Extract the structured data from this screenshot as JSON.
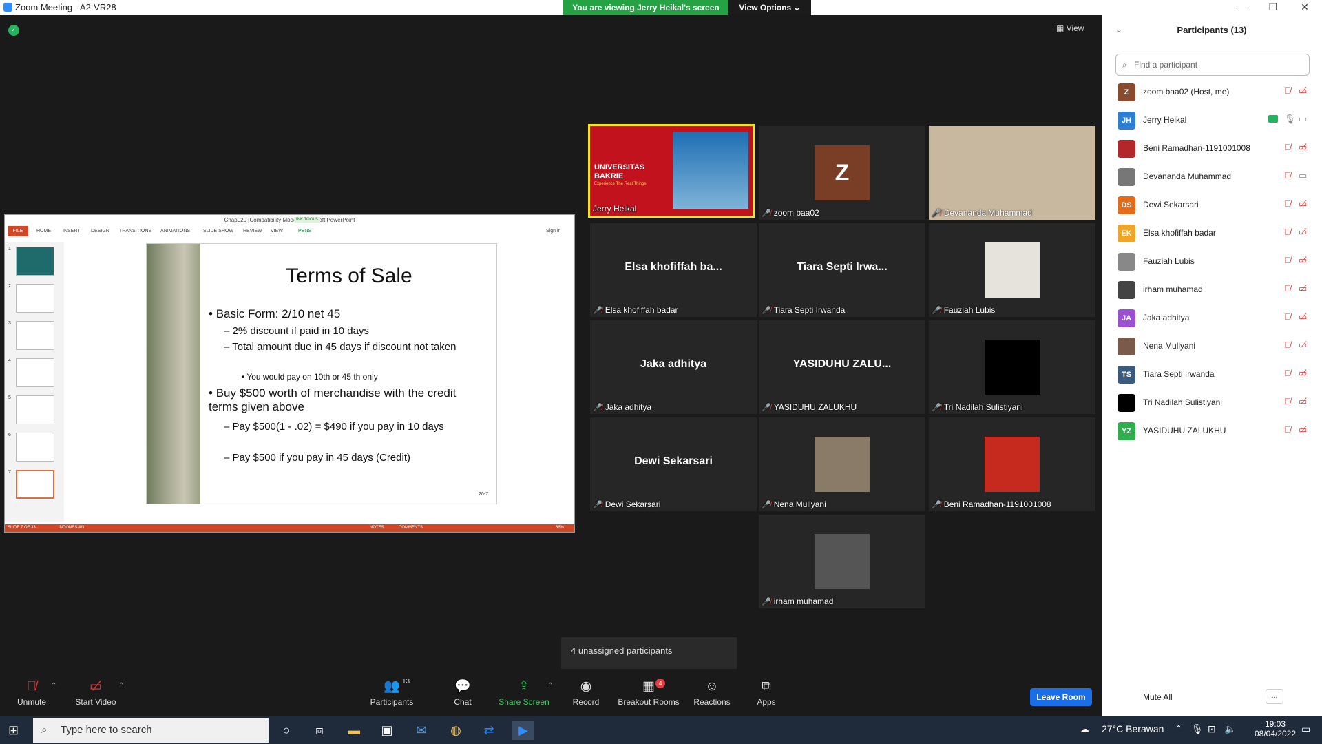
{
  "window": {
    "title": "Zoom Meeting - A2-VR28",
    "minimize": "—",
    "restore": "❐",
    "close": "✕"
  },
  "banner": {
    "viewing": "You are viewing Jerry Heikal's screen",
    "view_options": "View Options ⌄"
  },
  "view_button": "View",
  "ppt": {
    "window_title": "Chap020 [Compatibility Mode] - Microsoft PowerPoint",
    "ink_tools": "INK TOOLS",
    "tabs": [
      "FILE",
      "HOME",
      "INSERT",
      "DESIGN",
      "TRANSITIONS",
      "ANIMATIONS",
      "SLIDE SHOW",
      "REVIEW",
      "VIEW",
      "PENS"
    ],
    "signin": "Sign in",
    "thumb_numbers": [
      "1",
      "2",
      "3",
      "4",
      "5",
      "6",
      "7"
    ],
    "slide": {
      "title": "Terms of Sale",
      "bullet1": "Basic Form: 2/10 net 45",
      "sub1": "2% discount if paid in 10 days",
      "sub2": "Total amount due in 45 days if discount not taken",
      "subsub1": "You would pay on 10th or 45 th only",
      "bullet2": "Buy $500 worth of merchandise with the credit terms given above",
      "sub3": "Pay $500(1 - .02) = $490 if you pay in 10 days",
      "sub4": "Pay $500 if you pay in 45 days (Credit)",
      "number": "20-7"
    },
    "status": {
      "slide": "SLIDE 7 OF 33",
      "language": "INDONESIAN",
      "notes": "NOTES",
      "comments": "COMMENTS",
      "zoom": "86%"
    }
  },
  "tiles": [
    {
      "name": "Jerry Heikal",
      "banner1": "UNIVERSITAS",
      "banner2": "BAKRIE",
      "banner3": "Experience The Real Things"
    },
    {
      "name": "zoom baa02",
      "initial": "Z"
    },
    {
      "name": "Devananda Muhammad"
    },
    {
      "name": "Elsa khofiffah badar",
      "big": "Elsa khofiffah ba..."
    },
    {
      "name": "Tiara Septi Irwanda",
      "big": "Tiara Septi Irwa..."
    },
    {
      "name": "Fauziah Lubis"
    },
    {
      "name": "Jaka adhitya",
      "big": "Jaka adhitya"
    },
    {
      "name": "YASIDUHU ZALUKHU",
      "big": "YASIDUHU  ZALU..."
    },
    {
      "name": "Tri Nadilah Sulistiyani"
    },
    {
      "name": "Dewi Sekarsari",
      "big": "Dewi Sekarsari"
    },
    {
      "name": "Nena Mullyani"
    },
    {
      "name": "Beni Ramadhan-1191001008"
    },
    {
      "name": "irham muhamad"
    }
  ],
  "unassigned": "4 unassigned participants",
  "panel": {
    "title": "Participants (13)",
    "search_placeholder": "Find a participant",
    "participants": [
      {
        "initials": "Z",
        "name": "zoom baa02 (Host, me)",
        "color": "#8a4a2e"
      },
      {
        "initials": "JH",
        "name": "Jerry Heikal",
        "color": "#2d7fd3"
      },
      {
        "initials": "",
        "name": "Beni Ramadhan-1191001008",
        "color": "#b3262a"
      },
      {
        "initials": "",
        "name": "Devananda Muhammad",
        "color": "#777777"
      },
      {
        "initials": "DS",
        "name": "Dewi Sekarsari",
        "color": "#e36b1a"
      },
      {
        "initials": "EK",
        "name": "Elsa khofiffah badar",
        "color": "#efa626"
      },
      {
        "initials": "",
        "name": "Fauziah Lubis",
        "color": "#888888"
      },
      {
        "initials": "",
        "name": "irham muhamad",
        "color": "#444444"
      },
      {
        "initials": "JA",
        "name": "Jaka adhitya",
        "color": "#9b4fd1"
      },
      {
        "initials": "",
        "name": "Nena Mullyani",
        "color": "#7a5a4a"
      },
      {
        "initials": "TS",
        "name": "Tiara Septi Irwanda",
        "color": "#3b5a80"
      },
      {
        "initials": "",
        "name": "Tri Nadilah Sulistiyani",
        "color": "#000000"
      },
      {
        "initials": "YZ",
        "name": "YASIDUHU ZALUKHU",
        "color": "#2fae4e"
      }
    ],
    "mute_all": "Mute All",
    "more": "..."
  },
  "toolbar": {
    "unmute": "Unmute",
    "start_video": "Start Video",
    "participants": "Participants",
    "participants_count": "13",
    "chat": "Chat",
    "share_screen": "Share Screen",
    "record": "Record",
    "breakout": "Breakout Rooms",
    "breakout_count": "4",
    "reactions": "Reactions",
    "apps": "Apps",
    "leave": "Leave Room"
  },
  "taskbar": {
    "search": "Type here to search",
    "weather": "27°C  Berawan",
    "time": "19:03",
    "date": "08/04/2022"
  }
}
